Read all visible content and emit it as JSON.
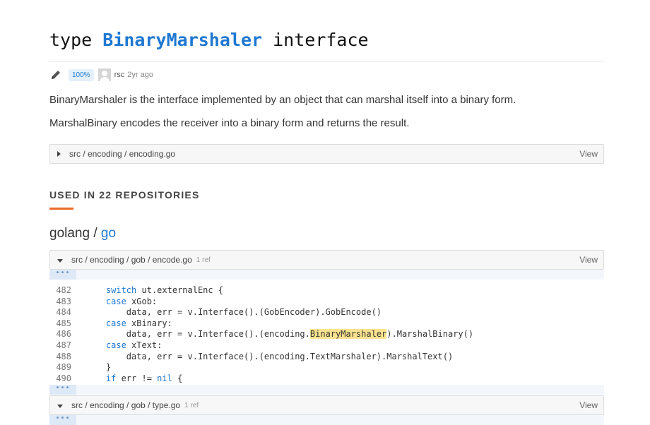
{
  "header": {
    "keyword": "type",
    "name": "BinaryMarshaler",
    "kind": "interface"
  },
  "meta": {
    "percent": "100%",
    "author": "rsc",
    "time": "2yr ago"
  },
  "doc": {
    "line1": "BinaryMarshaler is the interface implemented by an object that can marshal itself into a binary form.",
    "line2": "MarshalBinary encodes the receiver into a binary form and returns the result."
  },
  "definition_file": {
    "path": "src / encoding / encoding.go",
    "view_label": "View"
  },
  "used_in": {
    "label": "USED IN 22 REPOSITORIES"
  },
  "repo": {
    "owner": "golang",
    "separator": " / ",
    "name": "go"
  },
  "ellipsis": "•••",
  "files": [
    {
      "path": "src / encoding / gob / encode.go",
      "refs": "1 ref",
      "view_label": "View",
      "lines": [
        {
          "num": "482",
          "indent": "    ",
          "kw": "switch",
          "rest": " ut.externalEnc {"
        },
        {
          "num": "483",
          "indent": "    ",
          "kw": "case",
          "rest": " xGob:"
        },
        {
          "num": "484",
          "indent": "        ",
          "kw": "",
          "rest": "data, err = v.Interface().(GobEncoder).GobEncode()"
        },
        {
          "num": "485",
          "indent": "    ",
          "kw": "case",
          "rest": " xBinary:"
        },
        {
          "num": "486",
          "indent": "        ",
          "kw": "",
          "rest": "data, err = v.Interface().(encoding.",
          "highlight": "BinaryMarshaler",
          "after": ").MarshalBinary()"
        },
        {
          "num": "487",
          "indent": "    ",
          "kw": "case",
          "rest": " xText:"
        },
        {
          "num": "488",
          "indent": "        ",
          "kw": "",
          "rest": "data, err = v.Interface().(encoding.TextMarshaler).MarshalText()"
        },
        {
          "num": "489",
          "indent": "    ",
          "kw": "",
          "rest": "}"
        },
        {
          "num": "490",
          "indent": "    ",
          "kw": "if",
          "rest": " err != ",
          "kw2": "nil",
          "after": " {"
        }
      ]
    },
    {
      "path": "src / encoding / gob / type.go",
      "refs": "1 ref",
      "view_label": "View"
    }
  ],
  "colors": {
    "accent": "#1f78d1",
    "underline": "#ea6b2a",
    "highlight": "#fbe38e"
  }
}
